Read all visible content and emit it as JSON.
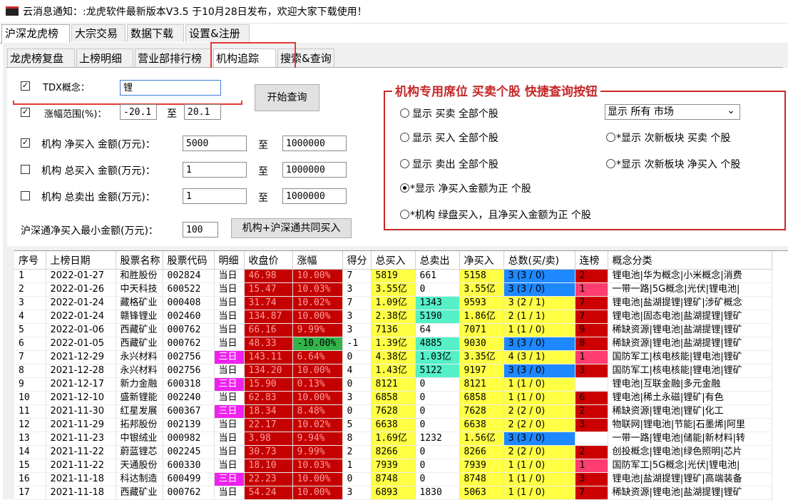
{
  "titlebar": {
    "title": "云消息通知：:龙虎软件最新版本V3.5 于10月28日发布，欢迎大家下载使用！"
  },
  "main_tabs": [
    "沪深龙虎榜",
    "大宗交易",
    "数据下载",
    "设置&注册"
  ],
  "sub_tabs": [
    "龙虎榜复盘",
    "上榜明细",
    "营业部排行榜",
    "机构追踪",
    "搜索&查询"
  ],
  "form": {
    "tdx_label": "TDX概念：",
    "tdx_value": "锂",
    "range_label": "涨幅范围(%)：",
    "range_from": "-20.1",
    "range_to": "20.1",
    "to": "至",
    "net_buy_label": "机构  净买入  金额(万元)：",
    "net_buy_from": "5000",
    "net_buy_to": "1000000",
    "total_buy_label": "机构  总买入  金额(万元)：",
    "total_buy_from": "1",
    "total_buy_to": "1000000",
    "total_sell_label": "机构  总卖出  金额(万元)：",
    "total_sell_from": "1",
    "total_sell_to": "1000000",
    "hsgt_label": "沪深通净买入最小金额(万元)：",
    "hsgt_value": "100",
    "start_button": "开始查询",
    "joint_button": "机构+沪深通共同买入"
  },
  "group": {
    "title": "机构专用席位  买卖个股  快捷查询按钮",
    "radios": [
      "显示  买卖  全部个股",
      "显示  买入  全部个股",
      "显示  卖出  全部个股",
      "*显示  净买入金额为正    个股",
      "*机构  绿盘买入，且净买入金额为正  个股",
      "*显示  次新板块    买卖  个股",
      "*显示  次新板块    净买入  个股"
    ],
    "market_select": "显示  所有  市场",
    "arrow": "⌄"
  },
  "table": {
    "headers": [
      "序号",
      "上榜日期",
      "股票名称",
      "股票代码",
      "明细",
      "收盘价",
      "涨幅",
      "得分",
      "总买入",
      "总卖出",
      "净买入",
      "总数(买/卖)",
      "连榜",
      "概念分类"
    ],
    "rows": [
      [
        "1",
        "2022-01-27",
        "和胜股份",
        "002824",
        "当日",
        "46.98",
        "10.00%",
        "7",
        "5819",
        "661",
        "5158",
        "3 (3 / 0)",
        "2",
        "锂电池|华为概念|小米概念|消费"
      ],
      [
        "2",
        "2022-01-26",
        "中天科技",
        "600522",
        "当日",
        "15.47",
        "10.03%",
        "3",
        "3.55亿",
        "0",
        "3.55亿",
        "3 (3 / 0)",
        "1",
        "一带一路|5G概念|光伏|锂电池|"
      ],
      [
        "3",
        "2022-01-24",
        "藏格矿业",
        "000408",
        "当日",
        "31.74",
        "10.02%",
        "7",
        "1.09亿",
        "1343",
        "9593",
        "3 (2 / 1)",
        "7",
        "锂电池|盐湖提锂|锂矿|涉矿概念"
      ],
      [
        "4",
        "2022-01-24",
        "赣锋锂业",
        "002460",
        "当日",
        "134.87",
        "10.00%",
        "3",
        "2.38亿",
        "5190",
        "1.86亿",
        "2 (1 / 1)",
        "7",
        "锂电池|固态电池|盐湖提锂|锂矿"
      ],
      [
        "5",
        "2022-01-06",
        "西藏矿业",
        "000762",
        "当日",
        "66.16",
        "9.99%",
        "3",
        "7136",
        "64",
        "7071",
        "1 (1 / 0)",
        "9",
        "稀缺资源|锂电池|盐湖提锂|锂矿"
      ],
      [
        "6",
        "2022-01-05",
        "西藏矿业",
        "000762",
        "当日",
        "48.33",
        "-10.00%",
        "-1",
        "1.39亿",
        "4885",
        "9030",
        "3 (3 / 0)",
        "8",
        "稀缺资源|锂电池|盐湖提锂|锂矿"
      ],
      [
        "7",
        "2021-12-29",
        "永兴材料",
        "002756",
        "三日",
        "143.11",
        "6.64%",
        "0",
        "4.38亿",
        "1.03亿",
        "3.35亿",
        "4 (3 / 1)",
        "1",
        "国防军工|核电核能|锂电池|锂矿"
      ],
      [
        "8",
        "2021-12-28",
        "永兴材料",
        "002756",
        "当日",
        "134.20",
        "10.00%",
        "4",
        "1.43亿",
        "5122",
        "9197",
        "3 (3 / 0)",
        "3",
        "国防军工|核电核能|锂电池|锂矿"
      ],
      [
        "9",
        "2021-12-17",
        "新力金融",
        "600318",
        "三日",
        "15.90",
        "0.13%",
        "0",
        "8121",
        "0",
        "8121",
        "1 (1 / 0)",
        "",
        "锂电池|互联金融|多元金融"
      ],
      [
        "10",
        "2021-12-10",
        "盛新锂能",
        "002240",
        "当日",
        "62.83",
        "10.00%",
        "3",
        "6858",
        "0",
        "6858",
        "1 (1 / 0)",
        "6",
        "锂电池|稀土永磁|锂矿|有色"
      ],
      [
        "11",
        "2021-11-30",
        "红星发展",
        "600367",
        "三日",
        "18.34",
        "8.48%",
        "0",
        "7628",
        "0",
        "7628",
        "2 (2 / 0)",
        "2",
        "稀缺资源|锂电池|锂矿|化工"
      ],
      [
        "12",
        "2021-11-29",
        "拓邦股份",
        "002139",
        "当日",
        "22.17",
        "10.02%",
        "5",
        "6638",
        "0",
        "6638",
        "2 (2 / 0)",
        "3",
        "物联网|锂电池|节能|石墨烯|阿里"
      ],
      [
        "13",
        "2021-11-23",
        "中银绒业",
        "000982",
        "当日",
        "3.98",
        "9.94%",
        "8",
        "1.69亿",
        "1232",
        "1.56亿",
        "3 (3 / 0)",
        "",
        "一带一路|锂电池|储能|新材料|转"
      ],
      [
        "14",
        "2021-11-22",
        "蔚蓝锂芯",
        "002245",
        "当日",
        "30.73",
        "9.99%",
        "2",
        "8266",
        "0",
        "8266",
        "2 (2 / 0)",
        "2",
        "创投概念|锂电池|绿色照明|芯片"
      ],
      [
        "15",
        "2021-11-22",
        "天通股份",
        "600330",
        "当日",
        "18.10",
        "10.03%",
        "1",
        "7939",
        "0",
        "7939",
        "1 (1 / 0)",
        "1",
        "国防军工|5G概念|光伏|锂电池|"
      ],
      [
        "16",
        "2021-11-18",
        "科达制造",
        "600499",
        "三日",
        "22.23",
        "10.00%",
        "0",
        "8748",
        "0",
        "8748",
        "1 (1 / 0)",
        "3",
        "锂电池|盐湖提锂|锂矿|高端装备"
      ],
      [
        "17",
        "2021-11-18",
        "西藏矿业",
        "000762",
        "当日",
        "54.24",
        "10.00%",
        "3",
        "6893",
        "1830",
        "5063",
        "1 (1 / 0)",
        "7",
        "稀缺资源|锂电池|盐湖提锂|锂矿"
      ]
    ]
  },
  "colors": {
    "accent_red": "#c62828",
    "cell_red": "#c40000",
    "cell_yellow": "#ffff44",
    "cell_teal": "#55f0c8",
    "cell_blue": "#1e88ff",
    "cell_magenta": "#ee22ee",
    "cell_green": "#33b34a"
  }
}
